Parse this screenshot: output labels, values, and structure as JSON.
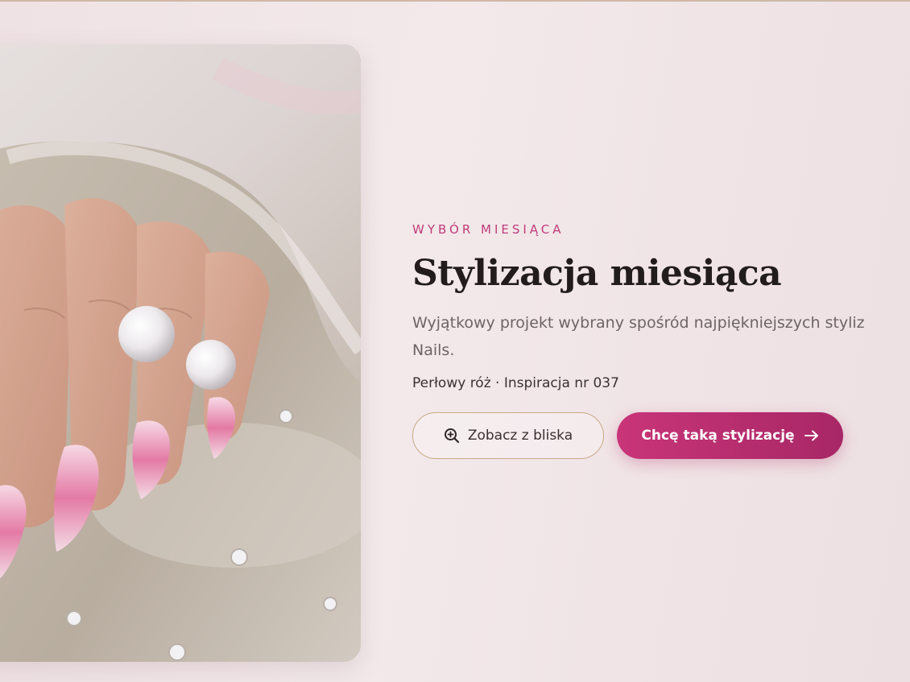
{
  "hero": {
    "eyebrow": "WYBÓR MIESIĄCA",
    "title": "Stylizacja miesiąca",
    "description": "Wyjątkowy projekt wybrany spośród najpiękniejszych styliz",
    "description_cont": "Nails.",
    "meta": "Perłowy róż · Inspiracja nr 037",
    "buttons": {
      "zoom_label": "Zobacz z bliska",
      "zoom_icon": "zoom-in-icon",
      "cta_label": "Chcę taką stylizację",
      "cta_icon": "arrow-right-icon"
    },
    "image": {
      "subject": "hand with pink pearl chrome almond nails and pearl earrings on satin fabric"
    }
  },
  "colors": {
    "accent": "#c13c7a",
    "cta_start": "#c83578",
    "cta_end": "#a82766",
    "outline_border": "#c9aa86",
    "background": "#f1e4e6"
  }
}
